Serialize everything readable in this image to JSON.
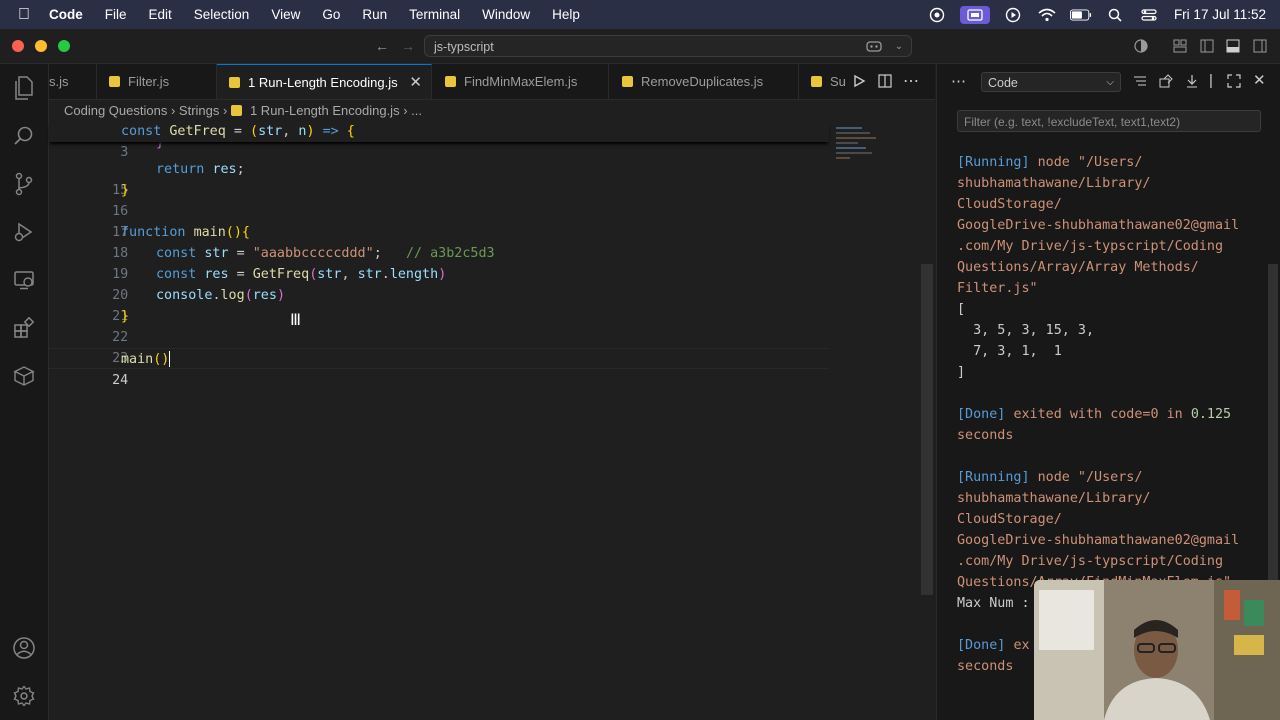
{
  "menubar": {
    "app_name": "Code",
    "items": [
      "File",
      "Edit",
      "Selection",
      "View",
      "Go",
      "Run",
      "Terminal",
      "Window",
      "Help"
    ],
    "clock": "Fri 17 Jul  11:52"
  },
  "titlebar": {
    "search": "js-typscript"
  },
  "tabs": [
    {
      "label": "s.js"
    },
    {
      "label": "Filter.js"
    },
    {
      "label": "1 Run-Length Encoding.js"
    },
    {
      "label": "FindMinMaxElem.js"
    },
    {
      "label": "RemoveDuplicates.js"
    },
    {
      "label": "Su"
    }
  ],
  "breadcrumb": {
    "part1": "Coding Questions",
    "part2": "Strings",
    "part3": "1 Run-Length Encoding.js",
    "part4": "..."
  },
  "editor": {
    "lines": [
      {
        "n": "3"
      },
      {
        "n": "14"
      },
      {
        "n": "15"
      },
      {
        "n": "16"
      },
      {
        "n": "17"
      },
      {
        "n": "18"
      },
      {
        "n": "19"
      },
      {
        "n": "20"
      },
      {
        "n": "21"
      },
      {
        "n": "22"
      },
      {
        "n": "23"
      },
      {
        "n": "24"
      }
    ],
    "tokens": {
      "l3": [
        "const",
        "GetFreq",
        "=",
        "(",
        "str",
        ",",
        "n",
        ")",
        "=>",
        "{"
      ],
      "l15": [
        "return",
        "res",
        ";"
      ],
      "l18": [
        "function",
        "main",
        "(){"
      ],
      "l19": [
        "const",
        "str",
        "=",
        "\"aaabbcccccddd\"",
        ";",
        "// a3b2c5d3"
      ],
      "l20": [
        "const",
        "res",
        "=",
        "GetFreq",
        "(",
        "str",
        ",",
        "str",
        ".",
        "length",
        ")"
      ],
      "l21": [
        "console",
        ".",
        "log",
        "(",
        "res",
        ")"
      ],
      "l24": [
        "main",
        "()"
      ]
    }
  },
  "panel": {
    "dropdown": "Code",
    "filter_placeholder": "Filter (e.g. text, !excludeText, text1,text2)",
    "output": {
      "running1": "[Running]",
      "cmd1_a": "node \"/Users/",
      "cmd1_b": "shubhamathawane/Library/",
      "cmd1_c": "CloudStorage/",
      "cmd1_d": "GoogleDrive-shubhamathawane02@gmail",
      "cmd1_e": ".com/My Drive/js-typscript/Coding",
      "cmd1_f": "Questions/Array/Array Methods/",
      "cmd1_g": "Filter.js\"",
      "arr_open": "[",
      "arr_1": "  3, 5, 3, 15, 3,",
      "arr_2": "  7, 3, 1,  1",
      "arr_close": "]",
      "done1": "[Done]",
      "done1_text": "exited with",
      "done1_code": "code=0",
      "done1_in": "in",
      "done1_time": "0.125",
      "done1_seconds": "seconds",
      "running2": "[Running]",
      "cmd2_a": "node \"/Users/",
      "cmd2_b": "shubhamathawane/Library/",
      "cmd2_c": "CloudStorage/",
      "cmd2_d": "GoogleDrive-shubhamathawane02@gmail",
      "cmd2_e": ".com/My Drive/js-typscript/Coding",
      "cmd2_f": "Questions/Array/FindMinMaxElem.js\"",
      "maxnum": "Max Num :",
      "done2": "[Done]",
      "done2_text": "ex",
      "done2_seconds": "seconds"
    }
  }
}
